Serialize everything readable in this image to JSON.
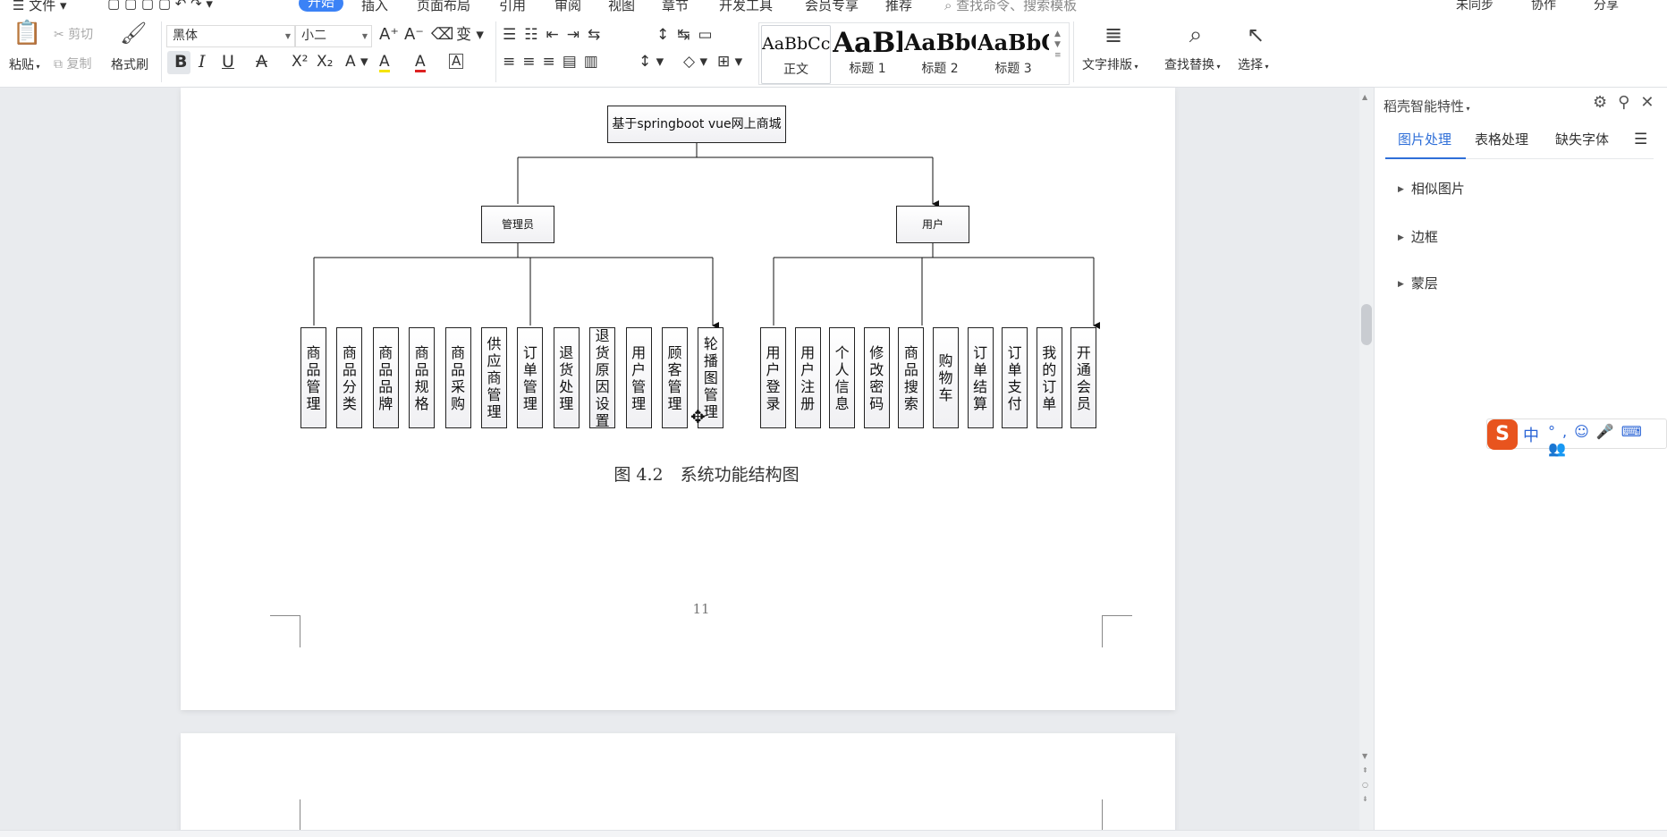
{
  "menu": {
    "file": "☰ 文件 ▾",
    "items": [
      "开始",
      "插入",
      "页面布局",
      "引用",
      "审阅",
      "视图",
      "章节",
      "开发工具",
      "会员专享",
      "推荐"
    ],
    "search_placeholder": "查找命令、搜索模板",
    "right": [
      "未同步",
      "协作",
      "分享"
    ]
  },
  "clipboard": {
    "paste": "粘贴",
    "cut": "剪切",
    "copy": "复制",
    "format_painter": "格式刷"
  },
  "font": {
    "name": "黑体",
    "size": "小二",
    "bold": "B",
    "italic": "I",
    "underline": "U",
    "strike": "A",
    "sup": "X²",
    "sub": "X₂",
    "highlight": "A",
    "color": "A",
    "char_border": "A",
    "clear": "变"
  },
  "styles": [
    {
      "preview": "AaBbCcDd",
      "name": "正文"
    },
    {
      "preview": "AaBl",
      "name": "标题 1"
    },
    {
      "preview": "AaBbC",
      "name": "标题 2"
    },
    {
      "preview": "AaBbC",
      "name": "标题 3"
    }
  ],
  "tools": {
    "layout": "文字排版",
    "find_replace": "查找替换",
    "select": "选择"
  },
  "taskpane": {
    "title": "稻壳智能特性",
    "tabs": [
      "图片处理",
      "表格处理",
      "缺失字体"
    ],
    "sections": [
      "相似图片",
      "边框",
      "蒙层"
    ]
  },
  "diagram": {
    "root": "基于springboot vue网上商城",
    "left_role": "管理员",
    "right_role": "用户",
    "admin_items": [
      "商品管理",
      "商品分类",
      "商品品牌",
      "商品规格",
      "商品采购",
      "供应商管理",
      "订单管理",
      "退货处理",
      "退货原因设置",
      "用户管理",
      "顾客管理",
      "轮播图管理"
    ],
    "user_items": [
      "用户登录",
      "用户注册",
      "个人信息",
      "修改密码",
      "商品搜索",
      "购物车",
      "订单结算",
      "订单支付",
      "我的订单",
      "开通会员"
    ]
  },
  "caption": "图 4.2　系统功能结构图",
  "page_number": "11",
  "ime": {
    "logo": "S",
    "mode": "中"
  },
  "colors": {
    "accent": "#3b82f6",
    "tab_active": "#2f6fd8",
    "ime": "#e8541e"
  }
}
